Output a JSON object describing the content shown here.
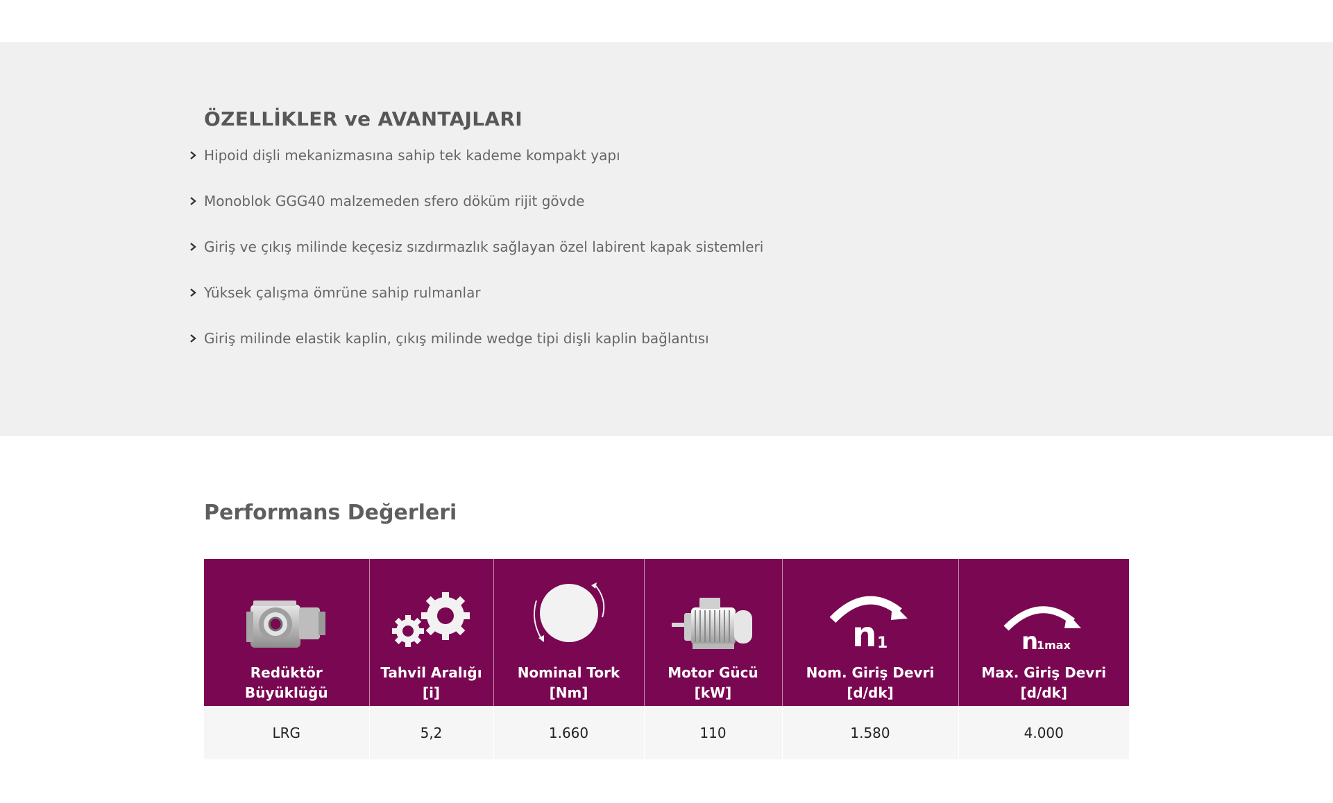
{
  "features": {
    "title": "ÖZELLİKLER ve AVANTAJLARI",
    "items": [
      "Hipoid dişli mekanizmasına sahip tek kademe kompakt yapı",
      "Monoblok GGG40 malzemeden sfero döküm rijit gövde",
      "Giriş ve çıkış milinde keçesiz sızdırmazlık sağlayan özel labirent kapak sistemleri",
      "Yüksek çalışma ömrüne sahip rulmanlar",
      "Giriş milinde elastik kaplin, çıkış milinde wedge tipi dişli kaplin bağlantısı"
    ]
  },
  "performance": {
    "title": "Performans Değerleri",
    "columns": [
      {
        "icon": "gearbox-icon",
        "label": "Redüktör",
        "unit": "Büyüklüğü"
      },
      {
        "icon": "gears-icon",
        "label": "Tahvil Aralığı",
        "unit": "[i]"
      },
      {
        "icon": "torque-icon",
        "label": "Nominal Tork",
        "unit": "[Nm]"
      },
      {
        "icon": "motor-icon",
        "label": "Motor Gücü",
        "unit": "[kW]"
      },
      {
        "icon": "speed-n1-icon",
        "label": "Nom. Giriş Devri",
        "unit": "[d/dk]",
        "symbol": "n",
        "sub": "1"
      },
      {
        "icon": "speed-n1max-icon",
        "label": "Max. Giriş Devri",
        "unit": "[d/dk]",
        "symbol": "n",
        "sub": "1max"
      }
    ],
    "rows": [
      [
        "LRG",
        "5,2",
        "1.660",
        "110",
        "1.580",
        "4.000"
      ]
    ]
  },
  "colors": {
    "header_bg": "#7a0751",
    "section_bg": "#f0f0f0",
    "row_bg": "#f6f6f6"
  }
}
